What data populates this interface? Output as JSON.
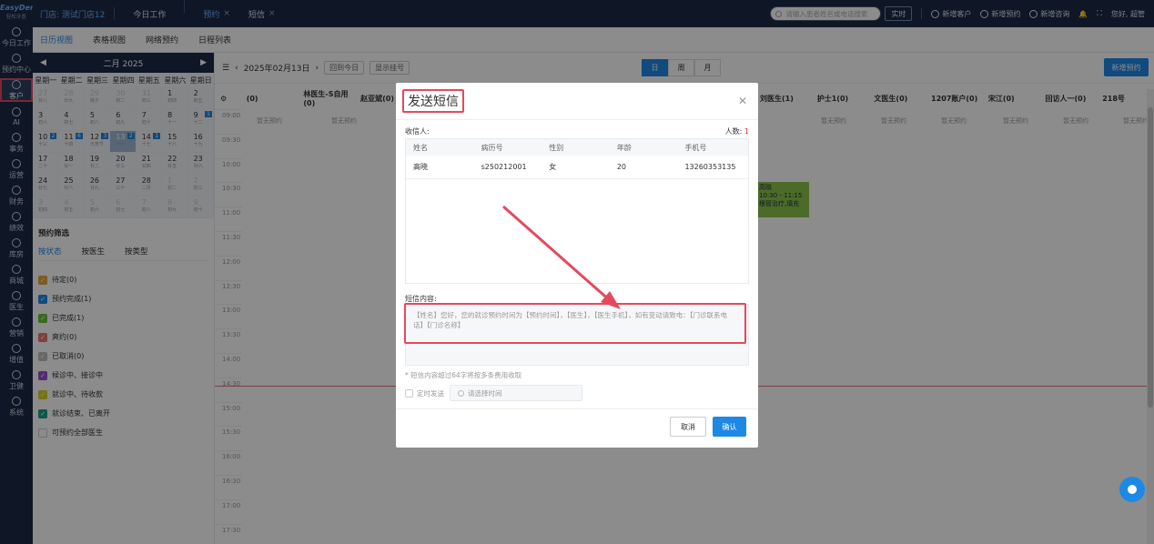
{
  "brand": {
    "name": "EasyDent",
    "sub": "轻松牙医"
  },
  "nav": [
    {
      "label": "今日工作",
      "icon": "home-icon"
    },
    {
      "label": "预约中心",
      "icon": "calendar-icon"
    },
    {
      "label": "客户",
      "icon": "user-icon",
      "active": true
    },
    {
      "label": "AI",
      "icon": "ai-icon"
    },
    {
      "label": "事务",
      "icon": "task-icon"
    },
    {
      "label": "运营",
      "icon": "operation-icon"
    },
    {
      "label": "财务",
      "icon": "finance-icon"
    },
    {
      "label": "绩效",
      "icon": "chart-icon"
    },
    {
      "label": "库房",
      "icon": "warehouse-icon"
    },
    {
      "label": "商城",
      "icon": "cart-icon"
    },
    {
      "label": "医生",
      "icon": "doctor-icon"
    },
    {
      "label": "营销",
      "icon": "marketing-icon"
    },
    {
      "label": "增值",
      "icon": "addon-icon"
    },
    {
      "label": "卫健",
      "icon": "health-icon"
    },
    {
      "label": "系统",
      "icon": "settings-icon"
    }
  ],
  "topbar": {
    "store": "门店: 测试门店12",
    "tabs": [
      {
        "label": "今日工作",
        "closable": false
      },
      {
        "label": "预约",
        "closable": true,
        "active": true
      },
      {
        "label": "短信",
        "closable": true
      }
    ],
    "search_placeholder": "请输入患者姓名或电话搜索",
    "realtime": "实时",
    "actions": [
      "新增客户",
      "新增预约",
      "新增咨询"
    ],
    "greeting": "您好, 超管"
  },
  "subtabs": [
    "日历视图",
    "表格视图",
    "网络预约",
    "日程列表"
  ],
  "calendar": {
    "month": "二月 2025",
    "weekdays": [
      "星期一",
      "星期二",
      "星期三",
      "星期四",
      "星期五",
      "星期六",
      "星期日"
    ],
    "days": [
      {
        "d": "27",
        "l": "廿八",
        "o": true
      },
      {
        "d": "28",
        "l": "廿九",
        "o": true
      },
      {
        "d": "29",
        "l": "除夕",
        "o": true
      },
      {
        "d": "30",
        "l": "初二",
        "o": true
      },
      {
        "d": "31",
        "l": "初三",
        "o": true
      },
      {
        "d": "1",
        "l": "初四"
      },
      {
        "d": "2",
        "l": "初五"
      },
      {
        "d": "3",
        "l": "初六"
      },
      {
        "d": "4",
        "l": "初七"
      },
      {
        "d": "5",
        "l": "初八"
      },
      {
        "d": "6",
        "l": "初九"
      },
      {
        "d": "7",
        "l": "初十"
      },
      {
        "d": "8",
        "l": "十一"
      },
      {
        "d": "9",
        "l": "十二",
        "c": "1"
      },
      {
        "d": "10",
        "l": "十三",
        "c": "2"
      },
      {
        "d": "11",
        "l": "十四",
        "c": "6"
      },
      {
        "d": "12",
        "l": "元宵节",
        "c": "3"
      },
      {
        "d": "13",
        "l": "十六",
        "c": "2",
        "t": true
      },
      {
        "d": "14",
        "l": "十七",
        "c": "1"
      },
      {
        "d": "15",
        "l": "十八"
      },
      {
        "d": "16",
        "l": "十九"
      },
      {
        "d": "17",
        "l": "二十"
      },
      {
        "d": "18",
        "l": "廿一"
      },
      {
        "d": "19",
        "l": "廿二"
      },
      {
        "d": "20",
        "l": "廿三"
      },
      {
        "d": "21",
        "l": "廿四"
      },
      {
        "d": "22",
        "l": "廿五"
      },
      {
        "d": "23",
        "l": "廿六"
      },
      {
        "d": "24",
        "l": "廿七"
      },
      {
        "d": "25",
        "l": "廿八"
      },
      {
        "d": "26",
        "l": "廿九"
      },
      {
        "d": "27",
        "l": "三十"
      },
      {
        "d": "28",
        "l": "二月"
      },
      {
        "d": "1",
        "l": "初二",
        "o": true
      },
      {
        "d": "2",
        "l": "初三",
        "o": true
      },
      {
        "d": "3",
        "l": "初四",
        "o": true
      },
      {
        "d": "4",
        "l": "初五",
        "o": true
      },
      {
        "d": "5",
        "l": "初六",
        "o": true
      },
      {
        "d": "6",
        "l": "初七",
        "o": true
      },
      {
        "d": "7",
        "l": "初八",
        "o": true
      },
      {
        "d": "8",
        "l": "初九",
        "o": true
      },
      {
        "d": "9",
        "l": "初十",
        "o": true
      }
    ]
  },
  "filter": {
    "title": "预约筛选",
    "tabs": [
      "按状态",
      "按医生",
      "按类型"
    ],
    "items": [
      {
        "label": "待定(0)",
        "color": "#e6a23c"
      },
      {
        "label": "预约完成(1)",
        "color": "#1e88e5"
      },
      {
        "label": "已完成(1)",
        "color": "#67c23a"
      },
      {
        "label": "爽约(0)",
        "color": "#e57373"
      },
      {
        "label": "已取消(0)",
        "color": "#bdbdbd"
      },
      {
        "label": "候诊中、接诊中",
        "color": "#9c4dcc"
      },
      {
        "label": "就诊中、待收款",
        "color": "#d4d22a"
      },
      {
        "label": "就诊结束、已离开",
        "color": "#16a085"
      },
      {
        "label": "可预约全部医生",
        "color": ""
      }
    ]
  },
  "toolbar": {
    "date": "2025年02月13日",
    "today_btn": "回到今日",
    "show_reg": "显示挂号",
    "views": [
      "日",
      "周",
      "月"
    ],
    "new_btn": "新增预约"
  },
  "columns": [
    "(0)",
    "林医生-S自用(0)",
    "赵亚斌(0)",
    "",
    "",
    "",
    "",
    "",
    "",
    "刘医生(1)",
    "护士1(0)",
    "文医生(0)",
    "1207账户(0)",
    "宋江(0)",
    "回访人一(0)",
    "218号"
  ],
  "times": [
    "09:00",
    "09:30",
    "10:00",
    "10:30",
    "11:00",
    "11:30",
    "12:00",
    "12:30",
    "13:00",
    "13:30",
    "14:00",
    "14:30",
    "15:00",
    "15:30",
    "16:00",
    "16:30",
    "17:00",
    "17:30"
  ],
  "no_appt": "暂无预约",
  "green_appt": {
    "name": "高晓",
    "time": "10:30 - 11:15",
    "type": "根管治疗,填充"
  },
  "modal": {
    "title": "发送短信",
    "recipient_label": "收信人:",
    "count_label": "人数:",
    "count": "1",
    "headers": [
      "姓名",
      "病历号",
      "性别",
      "年龄",
      "手机号"
    ],
    "rows": [
      [
        "高晓",
        "s250212001",
        "女",
        "20",
        "13260353135"
      ]
    ],
    "sms_label": "短信内容:",
    "sms_content": "【姓名】您好，您的就诊预约时间为【预约时间】，【医生】，【医生手机】，如有变动请致电：【门诊联系电话】【门诊名称】",
    "note": "* 短信内容超过64字将按多条费用收取",
    "timer_label": "定时发送",
    "time_placeholder": "请选择时间",
    "cancel": "取消",
    "confirm": "确认"
  },
  "colors": {
    "accent": "#1e88e5",
    "nav_bg": "#1d2b45",
    "highlight": "#e5485f"
  }
}
